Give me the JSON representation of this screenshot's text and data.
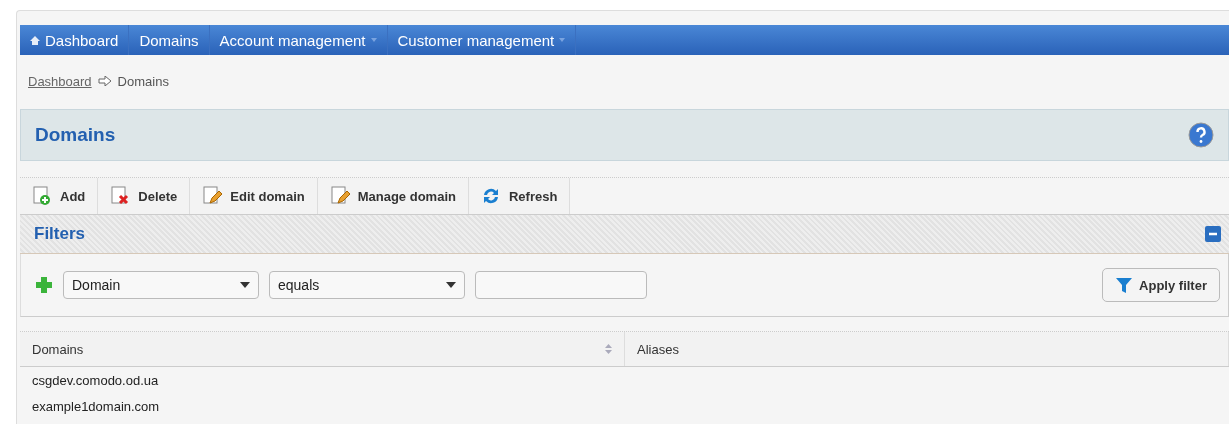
{
  "nav": [
    {
      "label": "Dashboard",
      "kind": "home"
    },
    {
      "label": "Domains",
      "kind": "link"
    },
    {
      "label": "Account management",
      "kind": "menu"
    },
    {
      "label": "Customer management",
      "kind": "menu"
    }
  ],
  "breadcrumb": {
    "link": "Dashboard",
    "current": "Domains"
  },
  "panel": {
    "title": "Domains"
  },
  "toolbar": [
    {
      "label": "Add",
      "kind": "add"
    },
    {
      "label": "Delete",
      "kind": "delete"
    },
    {
      "label": "Edit domain",
      "kind": "edit"
    },
    {
      "label": "Manage domain",
      "kind": "edit"
    },
    {
      "label": "Refresh",
      "kind": "refresh"
    }
  ],
  "filters": {
    "title": "Filters",
    "expanded": true,
    "field": "Domain",
    "operator": "equals",
    "apply": "Apply filter"
  },
  "table": {
    "columns": [
      "Domains",
      "Aliases"
    ],
    "rows": [
      [
        "csgdev.comodo.od.ua",
        ""
      ],
      [
        "example1domain.com",
        ""
      ]
    ]
  }
}
